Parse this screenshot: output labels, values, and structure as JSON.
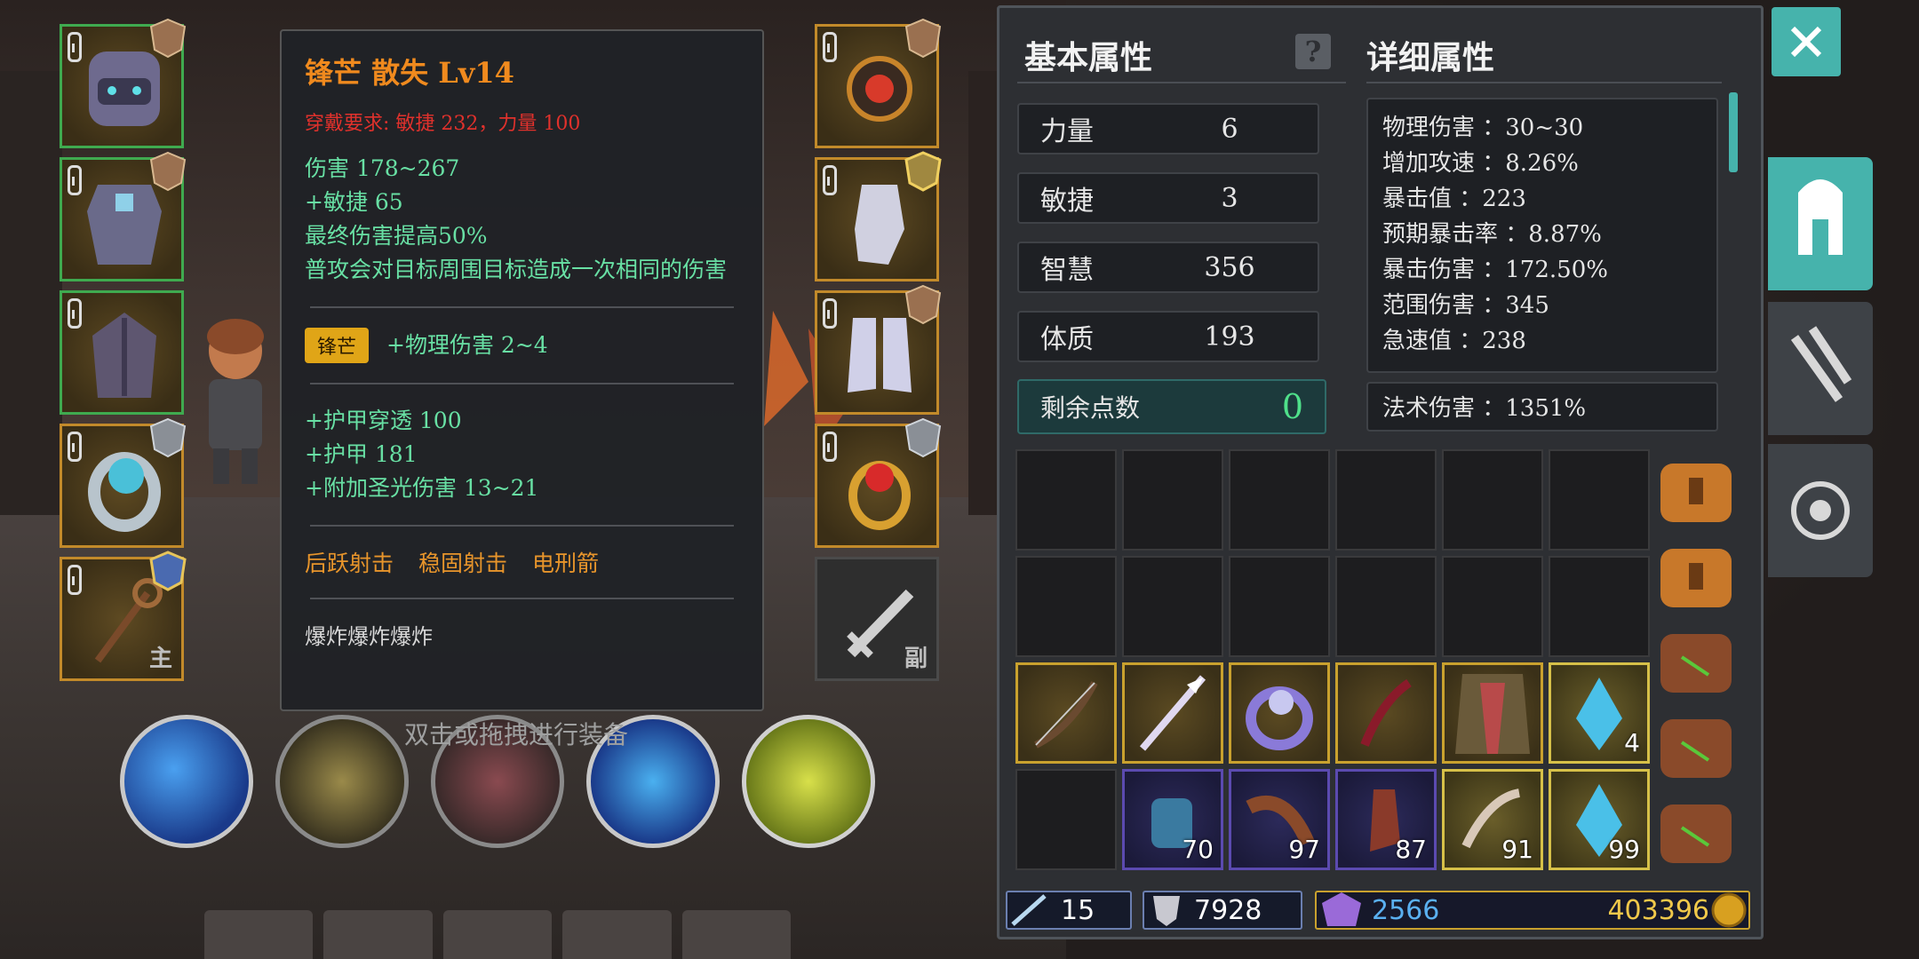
{
  "tooltip": {
    "title": "锋芒 散失 Lv14",
    "requirement": "穿戴要求:  敏捷 232，力量 100",
    "base_stats": [
      "伤害  178~267",
      "+敏捷 65",
      "最终伤害提高50%",
      "普攻会对目标周围目标造成一次相同的伤害"
    ],
    "gem_label": "锋芒",
    "gem_bonus": "+物理伤害 2~4",
    "extra_stats": [
      "+护甲穿透 100",
      "+护甲 181",
      "+附加圣光伤害 13~21"
    ],
    "skills": [
      "后跃射击",
      "稳固射击",
      "电刑箭"
    ],
    "description": "爆炸爆炸爆炸"
  },
  "equipment": {
    "main_label": "主",
    "off_label": "副"
  },
  "hint": "双击或拖拽进行装备",
  "panel": {
    "basic_title": "基本属性",
    "detail_title": "详细属性",
    "help_icon": "?",
    "basic_stats": [
      {
        "label": "力量",
        "value": "6"
      },
      {
        "label": "敏捷",
        "value": "3"
      },
      {
        "label": "智慧",
        "value": "356"
      },
      {
        "label": "体质",
        "value": "193"
      }
    ],
    "remaining_label": "剩余点数",
    "remaining_value": "0",
    "detail_stats": [
      "物理伤害 ：30~30",
      "增加攻速 ：8.26%",
      "暴击值 ：223",
      "预期暴击率 ：8.87%",
      "暴击伤害 ：172.50%",
      "范围伤害 ：345",
      "急速值 ：238"
    ],
    "magic_stat": "法术伤害 ：1351%"
  },
  "inventory_counts": {
    "crystal_a": "4",
    "item_70": "70",
    "item_97": "97",
    "item_87": "87",
    "item_91": "91",
    "crystal_b": "99"
  },
  "currency": {
    "arrows": "15",
    "shields": "7928",
    "gems": "2566",
    "gold": "403396"
  },
  "colors": {
    "accent_teal": "#46b3ac",
    "title_orange": "#f08a1e",
    "requirement_red": "#e0312c",
    "stat_green": "#68e0a4",
    "gold_border": "#c9a12e"
  }
}
